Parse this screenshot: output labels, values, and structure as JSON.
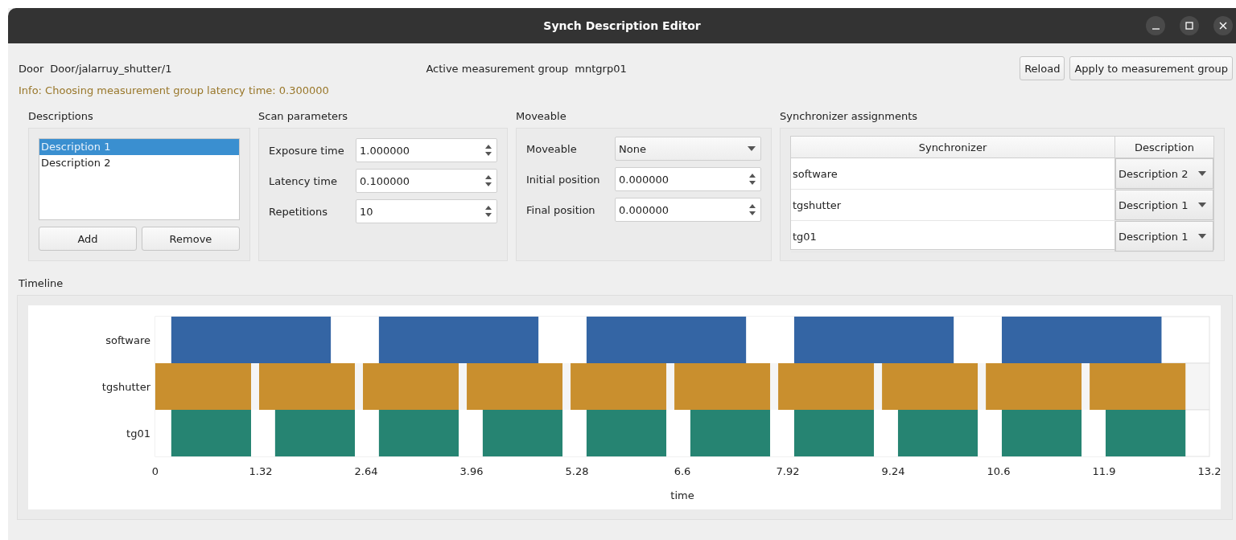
{
  "window": {
    "title": "Synch Description Editor"
  },
  "door": {
    "label": "Door",
    "value": "Door/jalarruy_shutter/1"
  },
  "active_group": {
    "label": "Active measurement group",
    "value": "mntgrp01"
  },
  "buttons": [
    "Reload",
    "Apply to measurement group"
  ],
  "info": "Info: Choosing measurement group latency time: 0.300000",
  "descriptions": {
    "title": "Descriptions",
    "items": [
      {
        "label": "Description 1",
        "selected": true
      },
      {
        "label": "Description 2",
        "selected": false
      }
    ],
    "buttons": [
      "Add",
      "Remove"
    ]
  },
  "scan_parameters": {
    "title": "Scan parameters",
    "fields": [
      {
        "label": "Exposure time",
        "kind": "spin",
        "value": "1.000000"
      },
      {
        "label": "Latency time",
        "kind": "spin",
        "value": "0.100000"
      },
      {
        "label": "Repetitions",
        "kind": "spin",
        "value": "10"
      }
    ]
  },
  "moveable": {
    "title": "Moveable",
    "fields": [
      {
        "label": "Moveable",
        "kind": "dropdown",
        "value": "None"
      },
      {
        "label": "Initial position",
        "kind": "spin",
        "value": "0.000000"
      },
      {
        "label": "Final position",
        "kind": "spin",
        "value": "0.000000"
      }
    ]
  },
  "synchronizer_assignments": {
    "title": "Synchronizer assignments",
    "columns": [
      "Synchronizer",
      "Description"
    ],
    "rows": [
      {
        "synchronizer": "software",
        "description": "Description 2"
      },
      {
        "synchronizer": "tgshutter",
        "description": "Description 1"
      },
      {
        "synchronizer": "tg01",
        "description": "Description 1"
      }
    ]
  },
  "timeline": {
    "title": "Timeline",
    "chart_data": {
      "type": "bar",
      "orientation": "horizontal",
      "xlabel": "time",
      "categories": [
        "software",
        "tgshutter",
        "tg01"
      ],
      "stacked": true,
      "series": [
        {
          "color": "#ffffff",
          "values": [
            0.2,
            null,
            null
          ]
        },
        {
          "color": "#3465a4",
          "values": [
            2.0,
            null,
            null
          ]
        },
        {
          "color": "#ffffff",
          "values": [
            0.6,
            null,
            null
          ]
        },
        {
          "color": "#3465a4",
          "values": [
            2.0,
            null,
            null
          ]
        },
        {
          "color": "#ffffff",
          "values": [
            0.6,
            null,
            null
          ]
        },
        {
          "color": "#3465a4",
          "values": [
            2.0,
            null,
            null
          ]
        },
        {
          "color": "#ffffff",
          "values": [
            0.6,
            null,
            null
          ]
        },
        {
          "color": "#3465a4",
          "values": [
            2.0,
            null,
            null
          ]
        },
        {
          "color": "#ffffff",
          "values": [
            0.6,
            null,
            null
          ]
        },
        {
          "color": "#3465a4",
          "values": [
            2.0,
            null,
            null
          ]
        },
        {
          "color": "#c98f2e",
          "values": [
            null,
            1.2,
            null
          ]
        },
        {
          "color": "#f5f5f5",
          "values": [
            null,
            0.1,
            null
          ]
        },
        {
          "color": "#c98f2e",
          "values": [
            null,
            1.2,
            null
          ]
        },
        {
          "color": "#f5f5f5",
          "values": [
            null,
            0.1,
            null
          ]
        },
        {
          "color": "#c98f2e",
          "values": [
            null,
            1.2,
            null
          ]
        },
        {
          "color": "#f5f5f5",
          "values": [
            null,
            0.1,
            null
          ]
        },
        {
          "color": "#c98f2e",
          "values": [
            null,
            1.2,
            null
          ]
        },
        {
          "color": "#f5f5f5",
          "values": [
            null,
            0.1,
            null
          ]
        },
        {
          "color": "#c98f2e",
          "values": [
            null,
            1.2,
            null
          ]
        },
        {
          "color": "#f5f5f5",
          "values": [
            null,
            0.1,
            null
          ]
        },
        {
          "color": "#c98f2e",
          "values": [
            null,
            1.2,
            null
          ]
        },
        {
          "color": "#f5f5f5",
          "values": [
            null,
            0.1,
            null
          ]
        },
        {
          "color": "#c98f2e",
          "values": [
            null,
            1.2,
            null
          ]
        },
        {
          "color": "#f5f5f5",
          "values": [
            null,
            0.1,
            null
          ]
        },
        {
          "color": "#c98f2e",
          "values": [
            null,
            1.2,
            null
          ]
        },
        {
          "color": "#f5f5f5",
          "values": [
            null,
            0.1,
            null
          ]
        },
        {
          "color": "#c98f2e",
          "values": [
            null,
            1.2,
            null
          ]
        },
        {
          "color": "#f5f5f5",
          "values": [
            null,
            0.1,
            null
          ]
        },
        {
          "color": "#c98f2e",
          "values": [
            null,
            1.2,
            null
          ]
        },
        {
          "color": "#ffffff",
          "values": [
            null,
            null,
            0.2
          ]
        },
        {
          "color": "#268472",
          "values": [
            null,
            null,
            1.0
          ]
        },
        {
          "color": "#ffffff",
          "values": [
            null,
            null,
            0.3
          ]
        },
        {
          "color": "#268472",
          "values": [
            null,
            null,
            1.0
          ]
        },
        {
          "color": "#ffffff",
          "values": [
            null,
            null,
            0.3
          ]
        },
        {
          "color": "#268472",
          "values": [
            null,
            null,
            1.0
          ]
        },
        {
          "color": "#ffffff",
          "values": [
            null,
            null,
            0.3
          ]
        },
        {
          "color": "#268472",
          "values": [
            null,
            null,
            1.0
          ]
        },
        {
          "color": "#ffffff",
          "values": [
            null,
            null,
            0.3
          ]
        },
        {
          "color": "#268472",
          "values": [
            null,
            null,
            1.0
          ]
        },
        {
          "color": "#ffffff",
          "values": [
            null,
            null,
            0.3
          ]
        },
        {
          "color": "#268472",
          "values": [
            null,
            null,
            1.0
          ]
        },
        {
          "color": "#ffffff",
          "values": [
            null,
            null,
            0.3
          ]
        },
        {
          "color": "#268472",
          "values": [
            null,
            null,
            1.0
          ]
        },
        {
          "color": "#ffffff",
          "values": [
            null,
            null,
            0.3
          ]
        },
        {
          "color": "#268472",
          "values": [
            null,
            null,
            1.0
          ]
        },
        {
          "color": "#ffffff",
          "values": [
            null,
            null,
            0.3
          ]
        },
        {
          "color": "#268472",
          "values": [
            null,
            null,
            1.0
          ]
        },
        {
          "color": "#ffffff",
          "values": [
            null,
            null,
            0.3
          ]
        },
        {
          "color": "#268472",
          "values": [
            null,
            null,
            1.0
          ]
        }
      ],
      "xlim": [
        0,
        13.2
      ],
      "xticks": [
        0,
        1.32,
        2.64,
        3.96,
        5.28,
        6.6,
        7.92,
        9.24,
        {
          "value": 10.56,
          "label": "10.6"
        },
        {
          "value": 11.88,
          "label": "11.9"
        },
        13.2
      ]
    }
  }
}
